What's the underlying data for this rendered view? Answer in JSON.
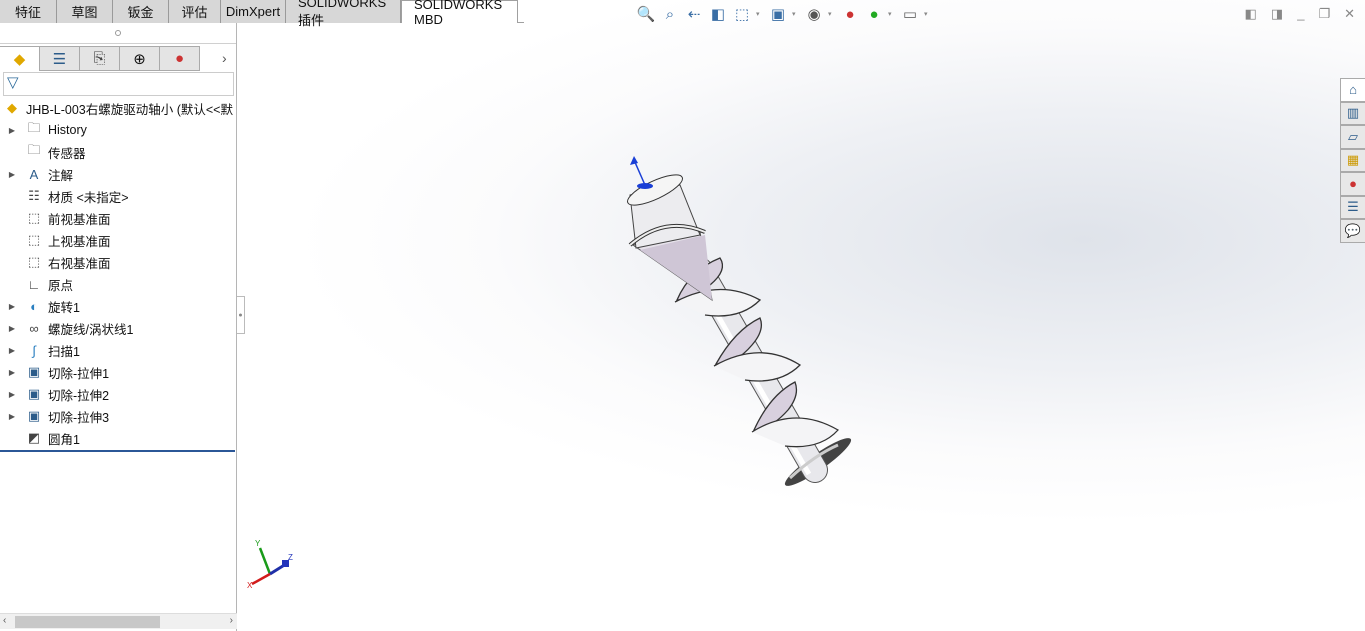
{
  "command_tabs": [
    {
      "label": "特征"
    },
    {
      "label": "草图"
    },
    {
      "label": "钣金"
    },
    {
      "label": "评估"
    },
    {
      "label": "DimXpert"
    },
    {
      "label": "SOLIDWORKS 插件"
    },
    {
      "label": "SOLIDWORKS MBD",
      "active": true
    }
  ],
  "panel_tabs": [
    {
      "icon": "feature-manager-icon"
    },
    {
      "icon": "property-manager-icon"
    },
    {
      "icon": "configuration-manager-icon"
    },
    {
      "icon": "dimxpert-manager-icon"
    },
    {
      "icon": "display-manager-icon"
    }
  ],
  "tree": {
    "root": "JHB-L-003右螺旋驱动轴小  (默认<<默",
    "items": [
      {
        "label": "History",
        "expandable": true,
        "icon": "history-folder-icon"
      },
      {
        "label": "传感器",
        "expandable": false,
        "icon": "sensor-folder-icon"
      },
      {
        "label": "注解",
        "expandable": true,
        "icon": "annotation-folder-icon"
      },
      {
        "label": "材质 <未指定>",
        "expandable": false,
        "icon": "material-icon"
      },
      {
        "label": "前视基准面",
        "expandable": false,
        "icon": "plane-icon"
      },
      {
        "label": "上视基准面",
        "expandable": false,
        "icon": "plane-icon"
      },
      {
        "label": "右视基准面",
        "expandable": false,
        "icon": "plane-icon"
      },
      {
        "label": "原点",
        "expandable": false,
        "icon": "origin-icon"
      },
      {
        "label": "旋转1",
        "expandable": true,
        "icon": "revolve-icon"
      },
      {
        "label": "螺旋线/涡状线1",
        "expandable": true,
        "icon": "helix-icon"
      },
      {
        "label": "扫描1",
        "expandable": true,
        "icon": "sweep-icon"
      },
      {
        "label": "切除-拉伸1",
        "expandable": true,
        "icon": "cut-extrude-icon"
      },
      {
        "label": "切除-拉伸2",
        "expandable": true,
        "icon": "cut-extrude-icon"
      },
      {
        "label": "切除-拉伸3",
        "expandable": true,
        "icon": "cut-extrude-icon"
      },
      {
        "label": "圆角1",
        "expandable": false,
        "icon": "fillet-icon"
      }
    ]
  },
  "heads_up_toolbar": [
    "zoom-to-fit-icon",
    "zoom-to-area-icon",
    "previous-view-icon",
    "section-view-icon",
    "view-orientation-icon",
    "display-style-icon",
    "hide-show-icon",
    "edit-appearance-icon",
    "apply-scene-icon",
    "view-settings-icon"
  ],
  "triad": {
    "x": "X",
    "y": "Y",
    "z": "Z"
  },
  "task_pane": [
    "home-icon",
    "design-library-icon",
    "file-explorer-icon",
    "view-palette-icon",
    "appearances-icon",
    "custom-properties-icon",
    "forum-icon"
  ]
}
